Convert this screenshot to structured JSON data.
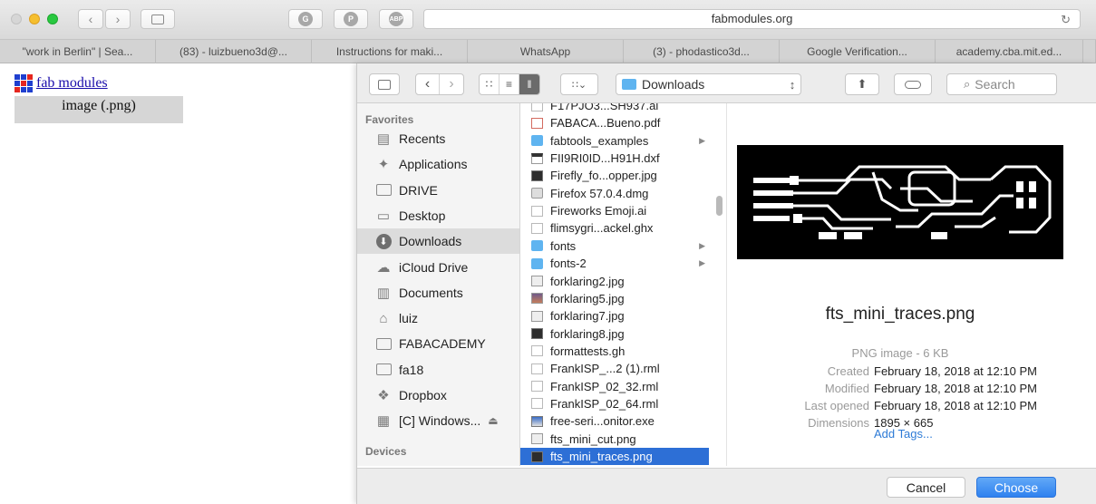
{
  "browser": {
    "url": "fabmodules.org",
    "tabs": [
      "\"work in Berlin\" | Sea...",
      "(83) - luizbueno3d@...",
      "Instructions for maki...",
      "WhatsApp",
      "(3) - phodastico3d...",
      "Google Verification...",
      "academy.cba.mit.ed..."
    ],
    "extensions": [
      "G",
      "P",
      "ABP"
    ]
  },
  "page": {
    "link_text": "fab modules",
    "format_button": "image (.png)"
  },
  "dialog": {
    "location": "Downloads",
    "search_placeholder": "Search",
    "sidebar": {
      "favorites_heading": "Favorites",
      "items": [
        {
          "label": "Recents",
          "icon": "recents-icon"
        },
        {
          "label": "Applications",
          "icon": "applications-icon"
        },
        {
          "label": "DRIVE",
          "icon": "folder-icon"
        },
        {
          "label": "Desktop",
          "icon": "desktop-icon"
        },
        {
          "label": "Downloads",
          "icon": "downloads-icon",
          "active": true
        },
        {
          "label": "iCloud Drive",
          "icon": "cloud-icon"
        },
        {
          "label": "Documents",
          "icon": "documents-icon"
        },
        {
          "label": "luiz",
          "icon": "home-icon"
        },
        {
          "label": "FABACADEMY",
          "icon": "folder-icon"
        },
        {
          "label": "fa18",
          "icon": "folder-icon"
        },
        {
          "label": "Dropbox",
          "icon": "dropbox-icon"
        },
        {
          "label": "[C] Windows...",
          "icon": "drive-icon",
          "eject": true
        }
      ],
      "devices_heading": "Devices"
    },
    "files": [
      {
        "name": "F17PJO3...SH937.ai",
        "kind": "doc"
      },
      {
        "name": "FABACA...Bueno.pdf",
        "kind": "pdf"
      },
      {
        "name": "fabtools_examples",
        "kind": "folder",
        "arrow": true
      },
      {
        "name": "FII9RI0ID...H91H.dxf",
        "kind": "dxf"
      },
      {
        "name": "Firefly_fo...opper.jpg",
        "kind": "image-dark"
      },
      {
        "name": "Firefox 57.0.4.dmg",
        "kind": "dmg"
      },
      {
        "name": "Fireworks Emoji.ai",
        "kind": "doc"
      },
      {
        "name": "flimsygri...ackel.ghx",
        "kind": "doc"
      },
      {
        "name": "fonts",
        "kind": "folder",
        "arrow": true
      },
      {
        "name": "fonts-2",
        "kind": "folder",
        "arrow": true
      },
      {
        "name": "forklaring2.jpg",
        "kind": "image-light"
      },
      {
        "name": "forklaring5.jpg",
        "kind": "image-color"
      },
      {
        "name": "forklaring7.jpg",
        "kind": "image-light"
      },
      {
        "name": "forklaring8.jpg",
        "kind": "image-dark"
      },
      {
        "name": "formattests.gh",
        "kind": "doc"
      },
      {
        "name": "FrankISP_...2 (1).rml",
        "kind": "doc"
      },
      {
        "name": "FrankISP_02_32.rml",
        "kind": "doc"
      },
      {
        "name": "FrankISP_02_64.rml",
        "kind": "doc"
      },
      {
        "name": "free-seri...onitor.exe",
        "kind": "exe"
      },
      {
        "name": "fts_mini_cut.png",
        "kind": "image-light"
      },
      {
        "name": "fts_mini_traces.png",
        "kind": "image-dark",
        "selected": true
      }
    ],
    "preview": {
      "filename": "fts_mini_traces.png",
      "type": "PNG image - 6 KB",
      "meta": [
        {
          "key": "Created",
          "value": "February 18, 2018 at 12:10 PM"
        },
        {
          "key": "Modified",
          "value": "February 18, 2018 at 12:10 PM"
        },
        {
          "key": "Last opened",
          "value": "February 18, 2018 at 12:10 PM"
        },
        {
          "key": "Dimensions",
          "value": "1895 × 665"
        }
      ],
      "add_tags": "Add Tags..."
    },
    "buttons": {
      "cancel": "Cancel",
      "choose": "Choose"
    }
  },
  "colors": {
    "accent": "#2d6fd6",
    "choose": "#3d8cf2",
    "folder": "#5fb4f0",
    "traffic": [
      "#d6d6d6",
      "#f5bf2f",
      "#29c840"
    ]
  }
}
